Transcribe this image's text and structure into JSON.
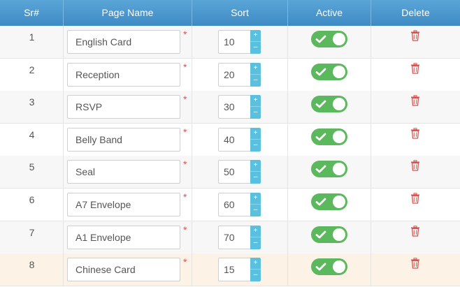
{
  "header": {
    "sr": "Sr#",
    "page_name": "Page Name",
    "sort": "Sort",
    "active": "Active",
    "delete": "Delete"
  },
  "required_mark": "*",
  "spinner": {
    "up": "+",
    "down": "–"
  },
  "rows": [
    {
      "sr": "1",
      "name": "English Card",
      "sort": "10",
      "active": true
    },
    {
      "sr": "2",
      "name": "Reception",
      "sort": "20",
      "active": true
    },
    {
      "sr": "3",
      "name": "RSVP",
      "sort": "30",
      "active": true
    },
    {
      "sr": "4",
      "name": "Belly Band",
      "sort": "40",
      "active": true
    },
    {
      "sr": "5",
      "name": "Seal",
      "sort": "50",
      "active": true
    },
    {
      "sr": "6",
      "name": "A7 Envelope",
      "sort": "60",
      "active": true
    },
    {
      "sr": "7",
      "name": "A1 Envelope",
      "sort": "70",
      "active": true
    },
    {
      "sr": "8",
      "name": "Chinese Card",
      "sort": "15",
      "active": true,
      "highlighted": true
    }
  ],
  "colors": {
    "header_top": "#5aa5d7",
    "header_bottom": "#3e8ac4",
    "toggle_on": "#5cb85c",
    "spinner": "#5bc0de",
    "required": "#d9534f",
    "delete_icon": "#d9534f",
    "highlight_row": "#fcf3e6"
  },
  "icons": {
    "active": "check-icon",
    "delete": "trash-icon"
  }
}
